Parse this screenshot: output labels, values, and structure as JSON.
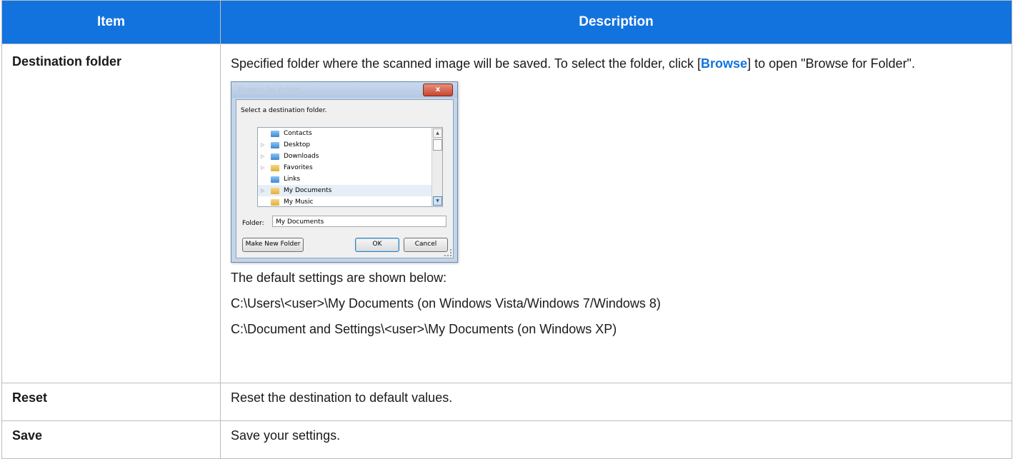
{
  "table": {
    "header": {
      "item": "Item",
      "description": "Description"
    },
    "rows": [
      {
        "item": "Destination folder",
        "desc_before_link": "Specified folder where the scanned image will be saved. To select the folder, click [",
        "link": "Browse",
        "desc_after_link": "] to open \"Browse for Folder\".",
        "defaults_intro": "The default settings are shown below:",
        "default_vista": "C:\\Users\\<user>\\My Documents (on Windows Vista/Windows 7/Windows 8)",
        "default_xp": "C:\\Document and Settings\\<user>\\My Documents (on Windows XP)"
      },
      {
        "item": "Reset",
        "description": "Reset the destination to default values."
      },
      {
        "item": "Save",
        "description": "Save your settings."
      }
    ]
  },
  "dialog": {
    "title": "Browse for Folder",
    "close_icon": "close-icon",
    "close_glyph": "x",
    "instruction": "Select a destination folder.",
    "tree_items": [
      {
        "label": "Contacts",
        "expandable": false,
        "icon": "contacts-folder-icon"
      },
      {
        "label": "Desktop",
        "expandable": true,
        "icon": "folder-icon"
      },
      {
        "label": "Downloads",
        "expandable": true,
        "icon": "folder-icon"
      },
      {
        "label": "Favorites",
        "expandable": true,
        "icon": "folder-icon"
      },
      {
        "label": "Links",
        "expandable": false,
        "icon": "folder-icon"
      },
      {
        "label": "My Documents",
        "expandable": true,
        "icon": "folder-icon",
        "selected": true
      },
      {
        "label": "My Music",
        "expandable": false,
        "icon": "folder-icon"
      }
    ],
    "folder_label": "Folder:",
    "folder_value": "My Documents",
    "make_new_folder": "Make New Folder",
    "ok": "OK",
    "cancel": "Cancel",
    "colors": {
      "header_bg": "#1273de",
      "link": "#1273de"
    }
  }
}
